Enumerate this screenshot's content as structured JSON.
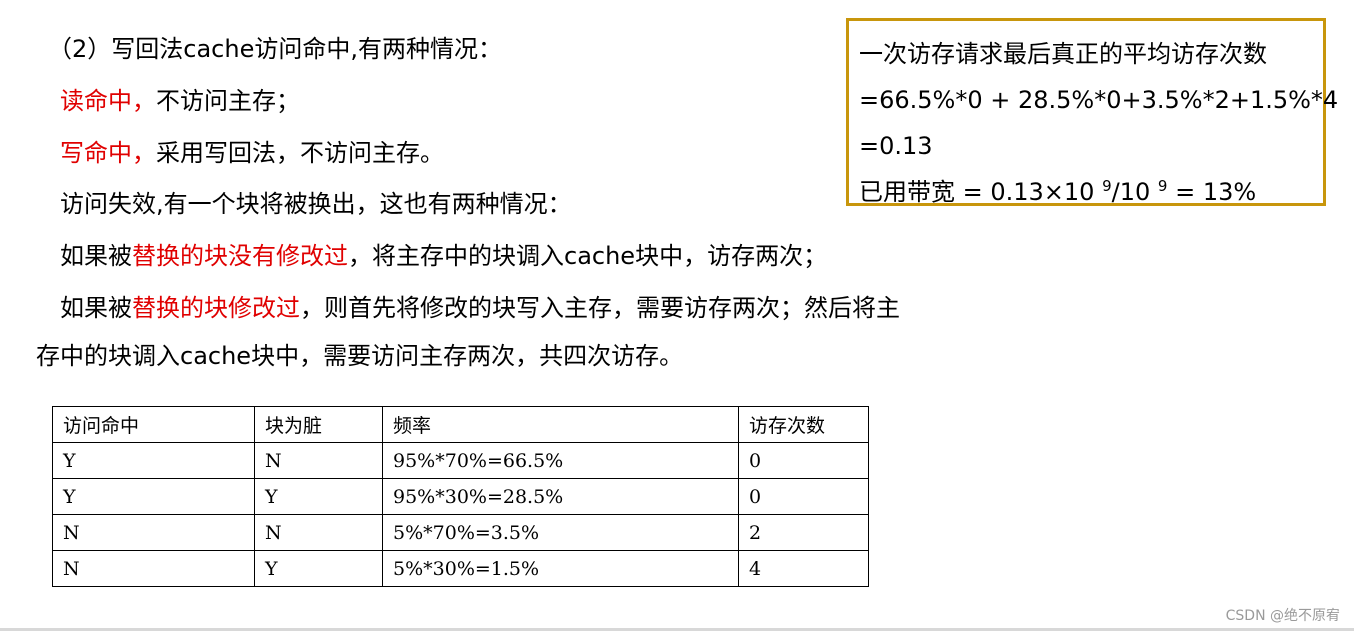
{
  "lines": {
    "l1": "（2）写回法cache访问命中,有两种情况：",
    "l2_red": "读命中，",
    "l2_rest": "不访问主存；",
    "l3_red": "写命中，",
    "l3_rest": "采用写回法，不访问主存。",
    "l4": "访问失效,有一个块将被换出，这也有两种情况：",
    "l5_a": "如果被",
    "l5_red": "替换的块没有修改过",
    "l5_b": "，将主存中的块调入cache块中，访存两次；",
    "l6_a": "如果被",
    "l6_red": "替换的块修改过",
    "l6_b": "，则首先将修改的块写入主存，需要访存两次；然后将主",
    "l7": "存中的块调入cache块中，需要访问主存两次，共四次访存。"
  },
  "box": {
    "line1": "一次访存请求最后真正的平均访存次数",
    "line2": "=66.5%*0 + 28.5%*0+3.5%*2+1.5%*4",
    "line3": "=0.13",
    "line4_a": "已用带宽 = 0.13×10 ",
    "line4_exp1": "9",
    "line4_b": "/10 ",
    "line4_exp2": "9",
    "line4_c": " = 13%"
  },
  "table": {
    "headers": [
      "访问命中",
      "块为脏",
      "频率",
      "访存次数"
    ],
    "rows": [
      [
        "Y",
        "N",
        "95%*70%=66.5%",
        "0"
      ],
      [
        "Y",
        "Y",
        "95%*30%=28.5%",
        "0"
      ],
      [
        "N",
        "N",
        "5%*70%=3.5%",
        "2"
      ],
      [
        "N",
        "Y",
        "5%*30%=1.5%",
        "4"
      ]
    ]
  },
  "watermark": "CSDN @绝不原宥"
}
